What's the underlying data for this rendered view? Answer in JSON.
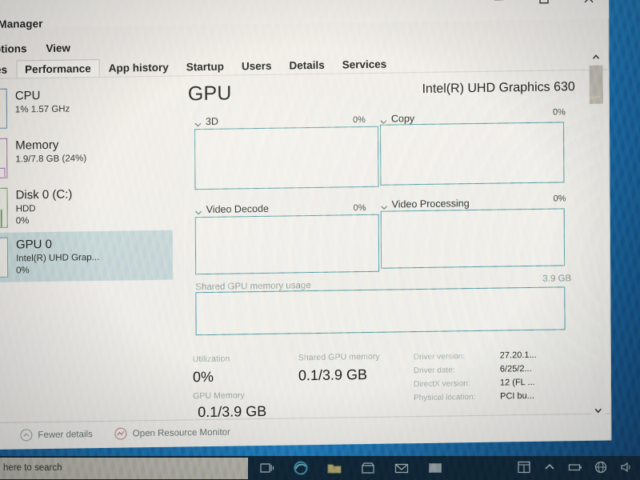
{
  "window": {
    "title": "sk Manager",
    "controls": [
      {
        "name": "minimize",
        "glyph": "—"
      },
      {
        "name": "maximize",
        "glyph": "□"
      },
      {
        "name": "close",
        "glyph": "✕"
      }
    ]
  },
  "menu": {
    "items": [
      "Options",
      "View"
    ]
  },
  "tabs": [
    {
      "label": "esses",
      "active": false
    },
    {
      "label": "Performance",
      "active": true
    },
    {
      "label": "App history",
      "active": false
    },
    {
      "label": "Startup",
      "active": false
    },
    {
      "label": "Users",
      "active": false
    },
    {
      "label": "Details",
      "active": false
    },
    {
      "label": "Services",
      "active": false
    }
  ],
  "sidebar": {
    "items": [
      {
        "title": "CPU",
        "sub1": "1% 1.57 GHz",
        "sub2": "",
        "selected": false,
        "color": "#5e7fa6"
      },
      {
        "title": "Memory",
        "sub1": "1.9/7.8 GB (24%)",
        "sub2": "",
        "selected": false,
        "color": "#a06ba6"
      },
      {
        "title": "Disk 0 (C:)",
        "sub1": "HDD",
        "sub2": "0%",
        "selected": false,
        "color": "#6e9b62"
      },
      {
        "title": "GPU 0",
        "sub1": "Intel(R) UHD Grap...",
        "sub2": "0%",
        "selected": true,
        "color": "#6e9aa6"
      }
    ]
  },
  "main": {
    "heading": "GPU",
    "device": "Intel(R) UHD Graphics 630",
    "graphs": [
      {
        "label": "3D",
        "percent": "0%"
      },
      {
        "label": "Copy",
        "percent": "0%"
      },
      {
        "label": "Video Decode",
        "percent": "0%"
      },
      {
        "label": "Video Processing",
        "percent": "0%"
      }
    ],
    "shared_memory": {
      "label": "Shared GPU memory usage",
      "max": "3.9 GB"
    }
  },
  "stats": {
    "utilization_label": "Utilization",
    "utilization_value": "0%",
    "gpu_memory_label": "GPU Memory",
    "gpu_memory_value": "0.1/3.9 GB",
    "shared_memory_label": "Shared GPU memory",
    "shared_memory_value": "0.1/3.9 GB",
    "details": [
      {
        "label": "Driver version:",
        "value": "27.20.1..."
      },
      {
        "label": "Driver date:",
        "value": "6/25/2..."
      },
      {
        "label": "DirectX version:",
        "value": "12 (FL ..."
      },
      {
        "label": "Physical location:",
        "value": "PCI bu..."
      }
    ]
  },
  "footer": {
    "fewer_details": "Fewer details",
    "open_resource_monitor": "Open Resource Monitor"
  },
  "taskbar": {
    "search_placeholder": "here to search"
  },
  "colors": {
    "graph_border": "#4f8f9e",
    "selected_row": "#c6d6da",
    "window_bg": "#f1efec",
    "taskbar": "#0e2436",
    "desktop": "#1763a5"
  }
}
